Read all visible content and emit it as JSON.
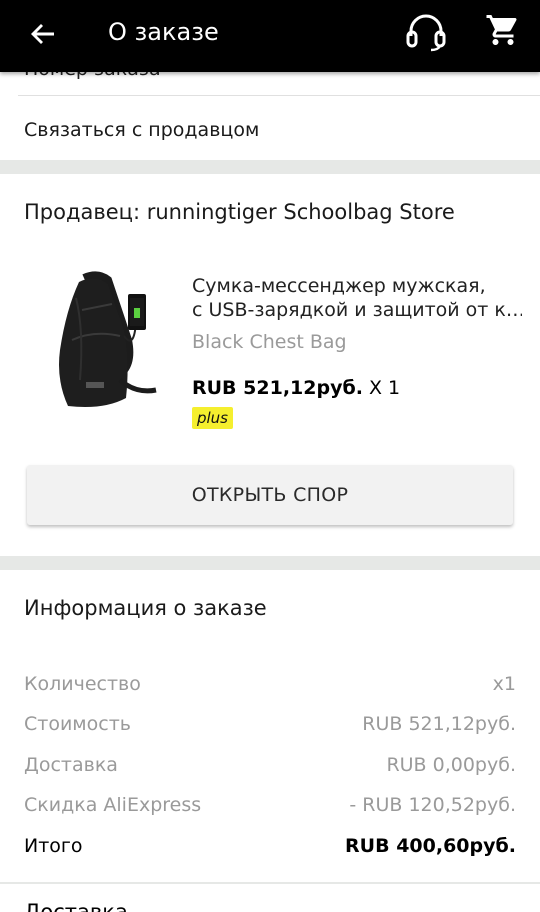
{
  "app_bar": {
    "title": "О заказе",
    "icons": [
      "back-arrow-icon",
      "headset-support-icon",
      "cart-icon"
    ]
  },
  "top_card": {
    "cut_off_text": "Номер заказа",
    "contact_seller": "Связаться с продавцом"
  },
  "seller_card": {
    "seller": "Продавец: runningtiger Schoolbag Store",
    "product": {
      "name_line1": "Сумка-мессенджер мужская,",
      "name_line2": "с USB-зарядкой и защитой от к…",
      "variant": "Black Chest Bag",
      "price": "RUB 521,12руб.",
      "quantity": "X 1",
      "badge": "plus",
      "badge_color": "#f5ef2e"
    },
    "dispute_button": "ОТКРЫТЬ СПОР"
  },
  "order_info": {
    "title": "Информация о заказе",
    "rows": [
      {
        "label": "Количество",
        "value": "x1"
      },
      {
        "label": "Стоимость",
        "value": "RUB 521,12руб."
      },
      {
        "label": "Доставка",
        "value": "RUB 0,00руб."
      },
      {
        "label": "Скидка AliExpress",
        "value": "- RUB 120,52руб."
      },
      {
        "label": "Итого",
        "value": "RUB 400,60руб."
      }
    ]
  },
  "bottom_card": {
    "cut_off_text": "Доставка"
  }
}
